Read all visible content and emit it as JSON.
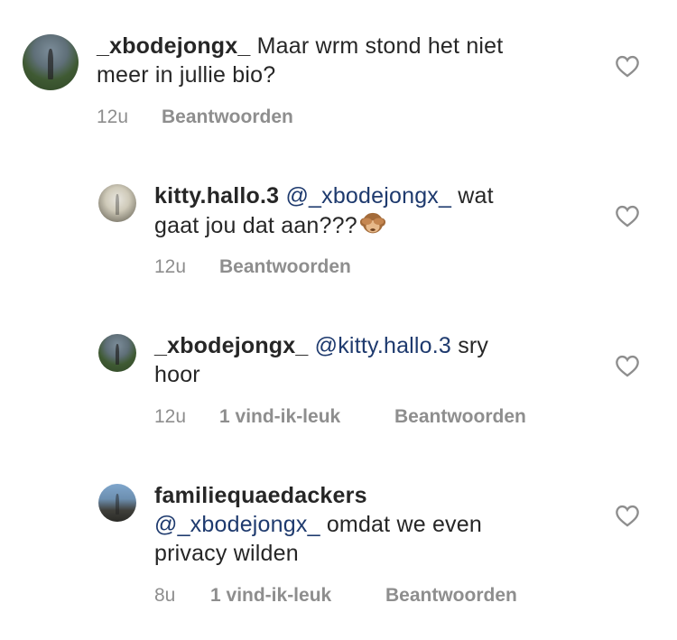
{
  "comments": [
    {
      "username": "_xbodejongx_",
      "mention": "",
      "text_line1": "Maar wrm stond het niet",
      "text_line2": "meer in jullie bio?",
      "time": "12u",
      "likes": "",
      "reply": "Beantwoorden"
    },
    {
      "username": "kitty.hallo.3",
      "mention": "@_xbodejongx_",
      "text_line1": " wat",
      "text_line2": "gaat jou dat aan???",
      "emoji": "see-no-evil-monkey",
      "time": "12u",
      "likes": "",
      "reply": "Beantwoorden"
    },
    {
      "username": "_xbodejongx_",
      "mention": "@kitty.hallo.3",
      "text_line1": " sry",
      "text_line2": "hoor",
      "time": "12u",
      "likes": "1 vind-ik-leuk",
      "reply": "Beantwoorden"
    },
    {
      "username": "familiequaedackers",
      "mention": "@_xbodejongx_",
      "text_line1": " omdat we even",
      "text_line2": "privacy wilden",
      "time": "8u",
      "likes": "1 vind-ik-leuk",
      "reply": "Beantwoorden"
    }
  ],
  "colors": {
    "mention": "#1e3a6e",
    "meta": "#8e8e8e",
    "text": "#262626"
  }
}
